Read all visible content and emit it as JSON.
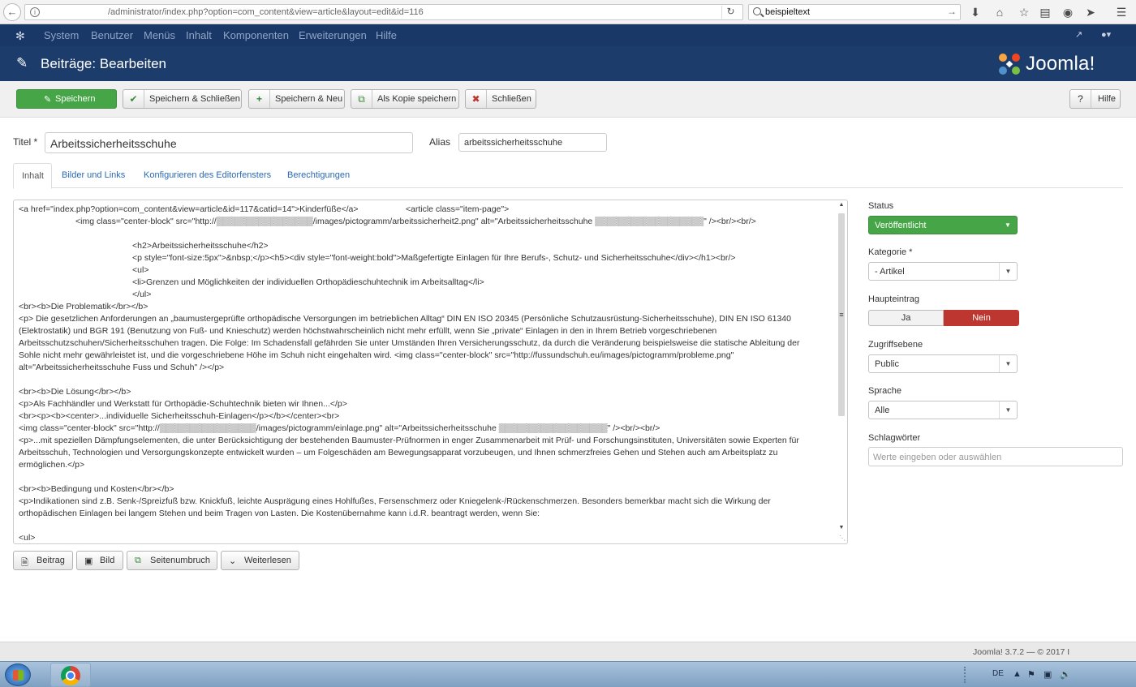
{
  "browser": {
    "url": "/administrator/index.php?option=com_content&view=article&layout=edit&id=116",
    "search": "beispieltext"
  },
  "nav": {
    "items": [
      "System",
      "Benutzer",
      "Menüs",
      "Inhalt",
      "Komponenten",
      "Erweiterungen",
      "Hilfe"
    ]
  },
  "header": {
    "title": "Beiträge: Bearbeiten",
    "brand": "Joomla!"
  },
  "toolbar": {
    "save": "Speichern",
    "save_close": "Speichern & Schließen",
    "save_new": "Speichern & Neu",
    "save_copy": "Als Kopie speichern",
    "close": "Schließen",
    "help": "Hilfe"
  },
  "form": {
    "title_label": "Titel *",
    "title_value": "Arbeitssicherheitsschuhe",
    "alias_label": "Alias",
    "alias_value": "arbeitssicherheitsschuhe"
  },
  "tabs": [
    "Inhalt",
    "Bilder und Links",
    "Konfigurieren des Editorfensters",
    "Berechtigungen"
  ],
  "editor": {
    "lines": [
      "<a href=\"index.php?option=com_content&view=article&id=117&catid=14\">Kinderfüße</a>                    <article class=\"item-page\">",
      "                        <img class=\"center-block\" src=\"http://▒▒▒▒▒▒▒▒▒▒▒▒▒▒▒▒/images/pictogramm/arbeitssicherheit2.png\" alt=\"Arbeitssicherheitsschuhe ▒▒▒▒▒▒▒▒▒▒▒▒▒▒▒▒▒▒\" /><br/><br/>",
      "",
      "                                                <h2>Arbeitssicherheitsschuhe</h2>",
      "                                                <p style=\"font-size:5px\">&nbsp;</p><h5><div style=\"font-weight:bold\">Maßgefertigte Einlagen für Ihre Berufs-, Schutz- und Sicherheitsschuhe</div></h1><br/>",
      "                                                <ul>",
      "                                                <li>Grenzen und Möglichkeiten der individuellen Orthopädieschuhtechnik im Arbeitsalltag</li>",
      "                                                </ul>",
      "<br><b>Die Problematik</br></b>",
      "<p> Die gesetzlichen Anforderungen an „baumustergeprüfte orthopädische Versorgungen im betrieblichen Alltag“ DIN EN ISO 20345 (Persönliche Schutzausrüstung-Sicherheitsschuhe), DIN EN ISO 61340",
      "(Elektrostatik) und BGR 191 (Benutzung von Fuß- und Knieschutz) werden höchstwahrscheinlich nicht mehr erfüllt, wenn Sie „private“ Einlagen in den in Ihrem Betrieb vorgeschriebenen",
      "Arbeitsschutzschuhen/Sicherheitsschuhen tragen. Die Folge: Im Schadensfall gefährden Sie unter Umständen Ihren Versicherungsschutz, da durch die Veränderung beispielsweise die statische Ableitung der",
      "Sohle nicht mehr gewährleistet ist, und die vorgeschriebene Höhe im Schuh nicht eingehalten wird. <img class=\"center-block\" src=\"http://fussundschuh.eu/images/pictogramm/probleme.png\"",
      "alt=\"Arbeitssicherheitsschuhe Fuss und Schuh\" /></p>",
      "",
      "<br><b>Die Lösung</br></b>",
      "<p>Als Fachhändler und Werkstatt für Orthopädie-Schuhtechnik bieten wir Ihnen...</p>",
      "<br><p><b><center>...individuelle Sicherheitsschuh-Einlagen</p></b></center><br>",
      "<img class=\"center-block\" src=\"http://▒▒▒▒▒▒▒▒▒▒▒▒▒▒▒▒/images/pictogramm/einlage.png\" alt=\"Arbeitssicherheitsschuhe ▒▒▒▒▒▒▒▒▒▒▒▒▒▒▒▒▒▒\" /><br/><br/>",
      "<p>...mit speziellen Dämpfungselementen, die unter Berücksichtigung der bestehenden Baumuster-Prüfnormen in enger Zusammenarbeit mit Prüf- und Forschungsinstituten, Universitäten sowie Experten für",
      "Arbeitsschuh, Technologien und Versorgungskonzepte entwickelt wurden – um Folgeschäden am Bewegungsapparat vorzubeugen, und Ihnen schmerzfreies Gehen und Stehen auch am Arbeitsplatz zu",
      "ermöglichen.</p>",
      "",
      "<br><b>Bedingung und Kosten</br></b>",
      "<p>Indikationen sind z.B. Senk-/Spreizfuß bzw. Knickfuß, leichte Ausprägung eines Hohlfußes, Fersenschmerz oder Kniegelenk-/Rückenschmerzen. Besonders bemerkbar macht sich die Wirkung der",
      "orthopädischen Einlagen bei langem Stehen und beim Tragen von Lasten. Die Kostenübernahme kann i.d.R. beantragt werden, wenn Sie:",
      "",
      "<ul>"
    ]
  },
  "editor_buttons": [
    "Beitrag",
    "Bild",
    "Seitenumbruch",
    "Weiterlesen"
  ],
  "sidebar": {
    "status_label": "Status",
    "status_value": "Veröffentlicht",
    "category_label": "Kategorie *",
    "category_value": "- Artikel",
    "featured_label": "Haupteintrag",
    "featured_yes": "Ja",
    "featured_no": "Nein",
    "access_label": "Zugriffsebene",
    "access_value": "Public",
    "language_label": "Sprache",
    "language_value": "Alle",
    "tags_label": "Schlagwörter",
    "tags_placeholder": "Werte eingeben oder auswählen"
  },
  "footer": {
    "text": "Joomla! 3.7.2 — © 2017 I"
  },
  "taskbar": {
    "lang": "DE"
  },
  "colors": {
    "nav_bg": "#1a3867",
    "header_bg": "#1c3d6b",
    "save_green": "#46a546",
    "nein_red": "#bd362f",
    "link_blue": "#2a69b8"
  }
}
